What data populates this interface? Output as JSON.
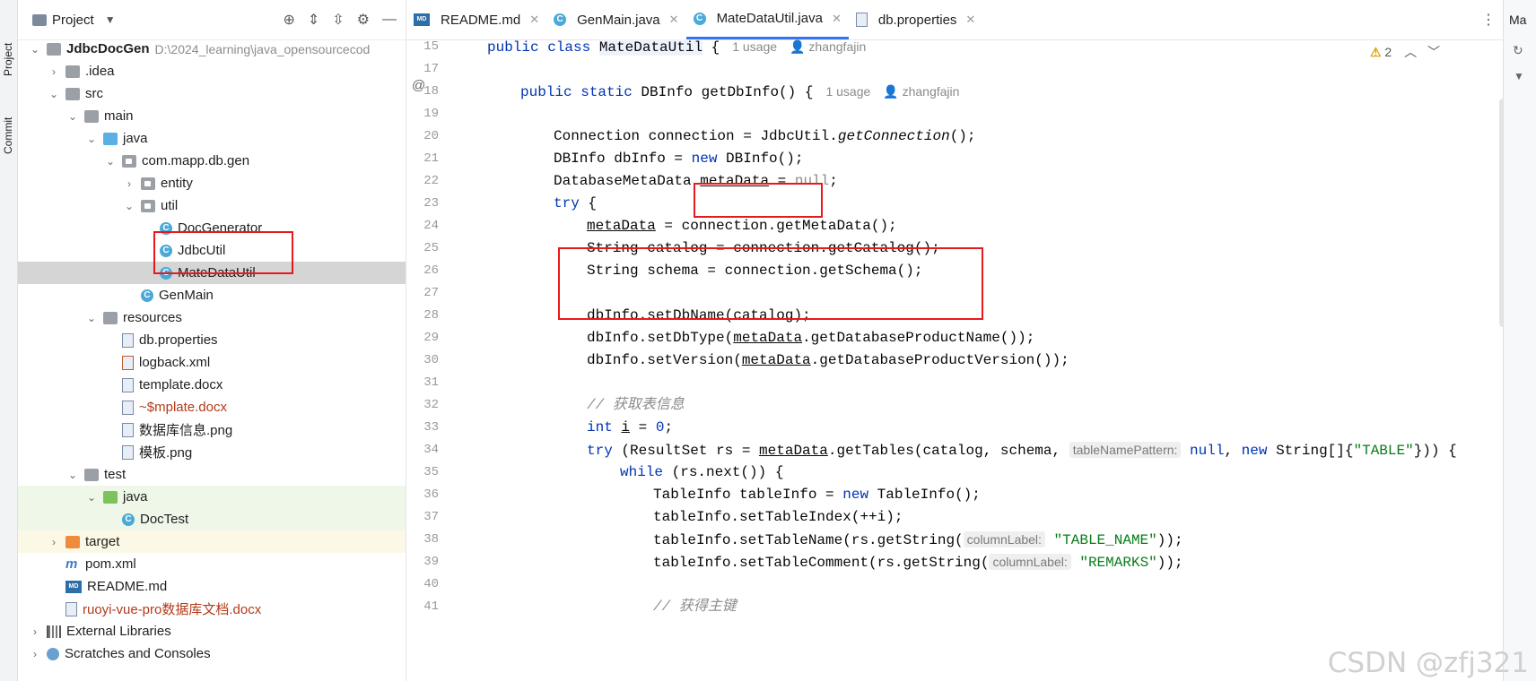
{
  "side_tabs": [
    "Project",
    "Commit"
  ],
  "project_panel": {
    "title": "Project",
    "tree": [
      {
        "indent": 0,
        "arrow": "v",
        "icon": "folder",
        "name": "JdbcDocGen",
        "bold": true,
        "path": "D:\\2024_learning\\java_opensourcecod"
      },
      {
        "indent": 1,
        "arrow": ">",
        "icon": "folder",
        "name": ".idea"
      },
      {
        "indent": 1,
        "arrow": "v",
        "icon": "folder",
        "name": "src"
      },
      {
        "indent": 2,
        "arrow": "v",
        "icon": "folder",
        "name": "main"
      },
      {
        "indent": 3,
        "arrow": "v",
        "icon": "folder-blue",
        "name": "java"
      },
      {
        "indent": 4,
        "arrow": "v",
        "icon": "package",
        "name": "com.mapp.db.gen"
      },
      {
        "indent": 5,
        "arrow": ">",
        "icon": "package",
        "name": "entity"
      },
      {
        "indent": 5,
        "arrow": "v",
        "icon": "package",
        "name": "util"
      },
      {
        "indent": 6,
        "arrow": "",
        "icon": "class",
        "name": "DocGenerator"
      },
      {
        "indent": 6,
        "arrow": "",
        "icon": "class",
        "name": "JdbcUtil"
      },
      {
        "indent": 6,
        "arrow": "",
        "icon": "class",
        "name": "MateDataUtil",
        "selected": true
      },
      {
        "indent": 5,
        "arrow": "",
        "icon": "class",
        "name": "GenMain"
      },
      {
        "indent": 3,
        "arrow": "v",
        "icon": "folder-res",
        "name": "resources"
      },
      {
        "indent": 4,
        "arrow": "",
        "icon": "file",
        "name": "db.properties"
      },
      {
        "indent": 4,
        "arrow": "",
        "icon": "xml",
        "name": "logback.xml"
      },
      {
        "indent": 4,
        "arrow": "",
        "icon": "file",
        "name": "template.docx"
      },
      {
        "indent": 4,
        "arrow": "",
        "icon": "file",
        "name": "~$mplate.docx",
        "red": true
      },
      {
        "indent": 4,
        "arrow": "",
        "icon": "file",
        "name": "数据库信息.png"
      },
      {
        "indent": 4,
        "arrow": "",
        "icon": "file",
        "name": "模板.png"
      },
      {
        "indent": 2,
        "arrow": "v",
        "icon": "folder",
        "name": "test"
      },
      {
        "indent": 3,
        "arrow": "v",
        "icon": "folder-green",
        "name": "java",
        "bg": "test"
      },
      {
        "indent": 4,
        "arrow": "",
        "icon": "class",
        "name": "DocTest",
        "bg": "test"
      },
      {
        "indent": 1,
        "arrow": ">",
        "icon": "folder-orange",
        "name": "target",
        "bg": "target"
      },
      {
        "indent": 1,
        "arrow": "",
        "icon": "maven",
        "name": "pom.xml"
      },
      {
        "indent": 1,
        "arrow": "",
        "icon": "md",
        "name": "README.md"
      },
      {
        "indent": 1,
        "arrow": "",
        "icon": "file",
        "name": "ruoyi-vue-pro数据库文档.docx",
        "red": true
      },
      {
        "indent": 0,
        "arrow": ">",
        "icon": "lib",
        "name": "External Libraries"
      },
      {
        "indent": 0,
        "arrow": ">",
        "icon": "scratch",
        "name": "Scratches and Consoles"
      }
    ]
  },
  "editor": {
    "tabs": [
      {
        "label": "README.md",
        "icon": "md",
        "active": false
      },
      {
        "label": "GenMain.java",
        "icon": "class",
        "active": false
      },
      {
        "label": "MateDataUtil.java",
        "icon": "class",
        "active": true
      },
      {
        "label": "db.properties",
        "icon": "file",
        "active": false
      }
    ],
    "warning_count": "2",
    "line_numbers": [
      "15",
      "17",
      "18",
      "19",
      "20",
      "21",
      "22",
      "23",
      "24",
      "25",
      "26",
      "27",
      "28",
      "29",
      "30",
      "31",
      "32",
      "33",
      "34",
      "35",
      "36",
      "37",
      "38",
      "39",
      "40",
      "41"
    ],
    "code": {
      "l15_kw": "public class ",
      "l15_name": "MateDataUtil",
      "l15_rest": " {",
      "l15_usage": "1 usage",
      "l15_author": "zhangfajin",
      "l18_kw": "public static ",
      "l18_rest": "DBInfo getDbInfo() {",
      "l18_usage": "1 usage",
      "l18_author": "zhangfajin",
      "l20_a": "Connection connection = JdbcUtil.",
      "l20_b": "getConnection",
      "l20_c": "();",
      "l21_a": "DBInfo dbInfo = ",
      "l21_b": "new",
      "l21_c": " DBInfo();",
      "l22_a": "DatabaseMetaData ",
      "l22_b": "metaData",
      "l22_c": " = ",
      "l22_d": "null",
      "l22_e": ";",
      "l23_a": "try",
      "l23_b": " {",
      "l24_a": "metaData",
      "l24_b": " = connection.getMetaData();",
      "l25": "String catalog = connection.getCatalog();",
      "l26": "String schema = connection.getSchema();",
      "l28": "dbInfo.setDbName(catalog);",
      "l29_a": "dbInfo.setDbType(",
      "l29_b": "metaData",
      "l29_c": ".getDatabaseProductName());",
      "l30_a": "dbInfo.setVersion(",
      "l30_b": "metaData",
      "l30_c": ".getDatabaseProductVersion());",
      "l32": "// 获取表信息",
      "l33_a": "int ",
      "l33_b": "i",
      "l33_c": " = ",
      "l33_d": "0",
      "l33_e": ";",
      "l34_a": "try",
      "l34_b": " (ResultSet rs = ",
      "l34_c": "metaData",
      "l34_d": ".getTables(catalog, schema, ",
      "l34_hint": "tableNamePattern:",
      "l34_e": " null",
      "l34_f": ", ",
      "l34_g": "new",
      "l34_h": " String[]{",
      "l34_i": "\"TABLE\"",
      "l34_j": "})) {",
      "l35_a": "while",
      "l35_b": " (rs.next()) {",
      "l36_a": "TableInfo tableInfo = ",
      "l36_b": "new",
      "l36_c": " TableInfo();",
      "l37": "tableInfo.setTableIndex(++i);",
      "l38_a": "tableInfo.setTableName(rs.getString(",
      "l38_hint": "columnLabel:",
      "l38_b": " \"TABLE_NAME\"",
      "l38_c": "));",
      "l39_a": "tableInfo.setTableComment(rs.getString(",
      "l39_hint": "columnLabel:",
      "l39_b": " \"REMARKS\"",
      "l39_c": "));",
      "l41": "// 获得主键"
    }
  },
  "right_panel": {
    "label": "Ma"
  },
  "watermark": "CSDN @zfj321"
}
